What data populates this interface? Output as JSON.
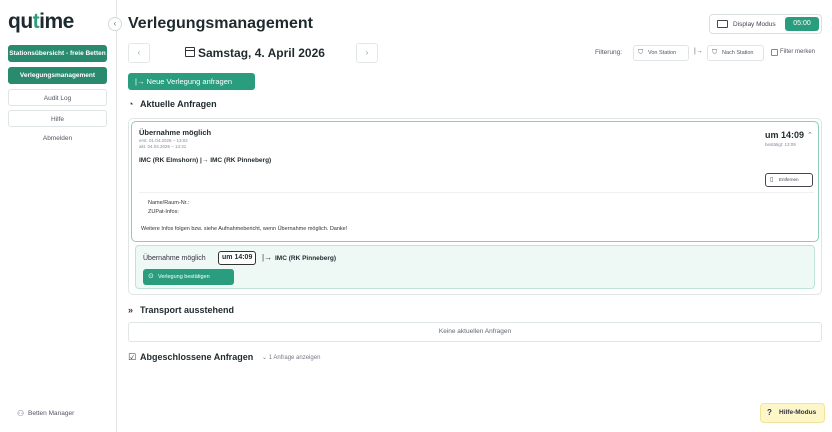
{
  "sidebar": {
    "logo_main": "qu",
    "logo_accent": "t",
    "logo_rest": "ime",
    "collapse_icon": "‹",
    "items": [
      {
        "label": "Stationsübersicht - freie Betten"
      },
      {
        "label": "Verlegungsmanagement"
      },
      {
        "label": "Audit Log"
      },
      {
        "label": "Hilfe"
      },
      {
        "label": "Abmelden"
      }
    ],
    "user": "Betten Manager"
  },
  "header": {
    "title": "Verlegungsmanagement",
    "display_mode_label": "Display Modus",
    "clock": "05:00"
  },
  "date_nav": {
    "prev": "‹",
    "next": "›",
    "date": "Samstag, 4. April 2026"
  },
  "filter": {
    "label": "Filterung:",
    "from_station": "Von Station",
    "arrow": "|→",
    "to_station": "Nach Station",
    "checkbox_label": "Filter merken"
  },
  "new_request": {
    "icon": "|→",
    "label": "Neue Verlegung anfragen"
  },
  "sections": {
    "current": "Aktuelle Anfragen",
    "transport": "Transport ausstehend",
    "completed": "Abgeschlossene Anfragen",
    "completed_toggle": "⌄ 1 Anfrage anzeigen"
  },
  "request": {
    "status": "Übernahme möglich",
    "meta_created": "erst. 01.04.2026 – 13:02",
    "meta_updated": "akt. 04.04.2026 – 13:31",
    "from": "IMC (RK Elmshorn)",
    "arrow": "|→",
    "to": "IMC (RK Pinneberg)",
    "time": "um 14:09",
    "time_sub": "bestätigt: 13:09",
    "chevron": "⌃",
    "delete_label": "Entfernen",
    "note_name": "Name/Raum-Nr.:",
    "note_info": "ZUPat-Infos:",
    "note_text": "Weitere Infos folgen bzw. siehe Aufnahmebericht, wenn Übernahme möglich. Danke!"
  },
  "confirm": {
    "status": "Übernahme möglich",
    "time": "um 14:09",
    "arrow": "|→",
    "to": "IMC (RK Pinneberg)",
    "button": "Verlegung bestätigen"
  },
  "transport": {
    "empty": "Keine aktuellen Anfragen"
  },
  "help": {
    "label": "Hilfe-Modus"
  }
}
